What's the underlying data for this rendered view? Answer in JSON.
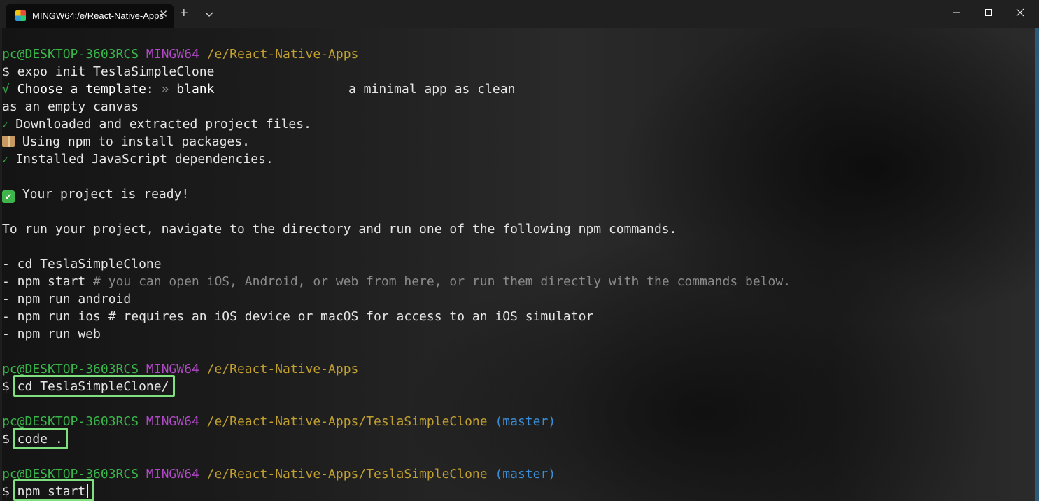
{
  "window": {
    "tab_title": "MINGW64:/e/React-Native-Apps",
    "tab_close": "✕",
    "new_tab": "+",
    "dropdown": "⌵",
    "minimize": "—",
    "maximize": "☐",
    "close": "✕"
  },
  "terminal": {
    "prompt1": {
      "user": "pc@DESKTOP-3603RCS",
      "shell": "MINGW64",
      "path": "/e/React-Native-Apps"
    },
    "cmd_expo": "$ expo init TeslaSimpleClone",
    "choose_tick": "√",
    "choose_label": " Choose a template: ",
    "choose_arrow": "»",
    "choose_value": " blank",
    "choose_desc": "a minimal app as clean",
    "choose_desc2": "as an empty canvas",
    "downloaded_tick": "✓",
    "downloaded": " Downloaded and extracted project files.",
    "using_npm": " Using npm to install packages.",
    "installed_tick": "✓",
    "installed": " Installed JavaScript dependencies.",
    "ready_check": "✔",
    "ready": " Your project is ready!",
    "to_run": "To run your project, navigate to the directory and run one of the following npm commands.",
    "cmd_cd": "- cd TeslaSimpleClone",
    "cmd_start": "- npm start",
    "cmd_start_comment": " # you can open iOS, Android, or web from here, or run them directly with the commands below.",
    "cmd_android": "- npm run android",
    "cmd_ios": "- npm run ios # requires an iOS device or macOS for access to an iOS simulator",
    "cmd_web": "- npm run web",
    "prompt2": {
      "user": "pc@DESKTOP-3603RCS",
      "shell": "MINGW64",
      "path": "/e/React-Native-Apps"
    },
    "dollar": "$",
    "input_cd": " cd TeslaSimpleClone/",
    "prompt3": {
      "user": "pc@DESKTOP-3603RCS",
      "shell": "MINGW64",
      "path": "/e/React-Native-Apps/TeslaSimpleClone",
      "branch": "(master)"
    },
    "input_code": " code .",
    "prompt4": {
      "user": "pc@DESKTOP-3603RCS",
      "shell": "MINGW64",
      "path": "/e/React-Native-Apps/TeslaSimpleClone",
      "branch": "(master)"
    },
    "input_npm": " npm start"
  },
  "colors": {
    "user": "#39b54a",
    "shell": "#b148c6",
    "path": "#c1a02f",
    "branch": "#3a8ed8",
    "highlight": "#7ee07e"
  }
}
